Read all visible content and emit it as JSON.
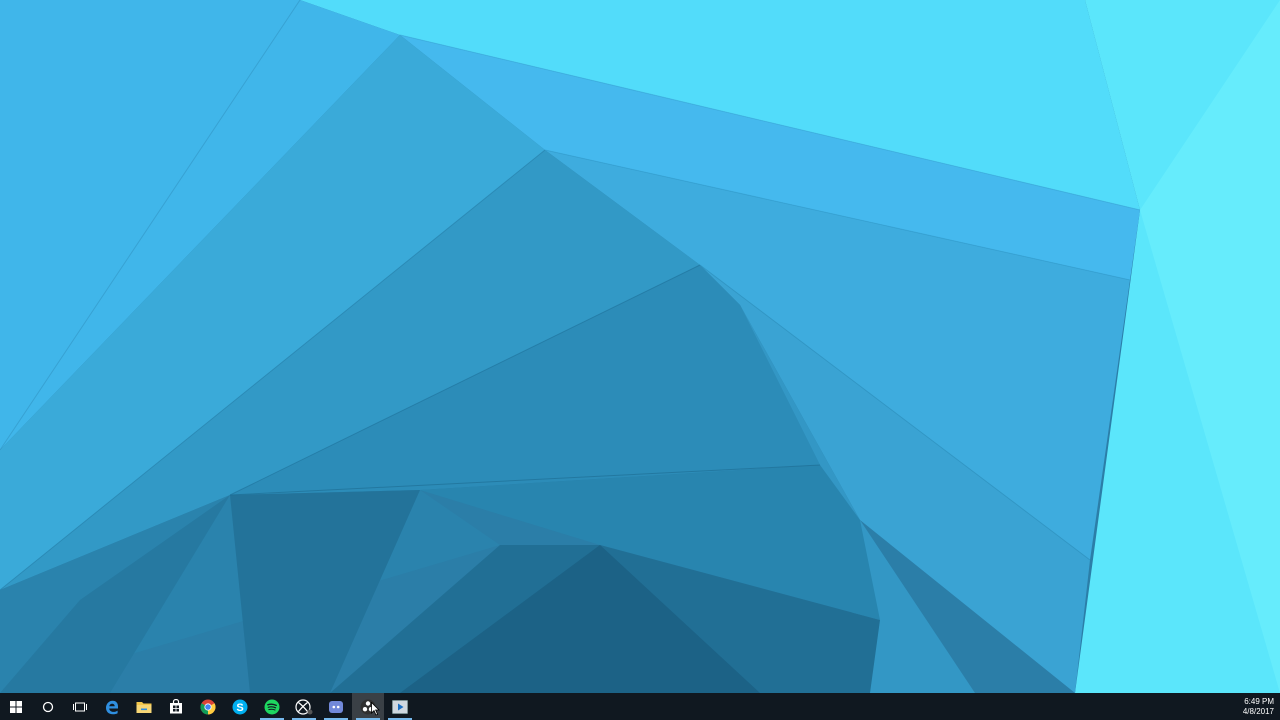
{
  "desktop": {
    "wallpaper_name": "geometric-blue-wallpaper"
  },
  "taskbar": {
    "items": [
      {
        "name": "start-button",
        "icon": "windows-logo-icon",
        "running": false
      },
      {
        "name": "search-button",
        "icon": "cortana-circle-icon",
        "running": false
      },
      {
        "name": "task-view-button",
        "icon": "task-view-icon",
        "running": false
      },
      {
        "name": "edge-button",
        "icon": "edge-icon",
        "running": false
      },
      {
        "name": "file-explorer-button",
        "icon": "folder-icon",
        "running": false
      },
      {
        "name": "store-button",
        "icon": "store-bag-icon",
        "running": false
      },
      {
        "name": "chrome-button",
        "icon": "chrome-icon",
        "running": false
      },
      {
        "name": "skype-button",
        "icon": "skype-icon",
        "running": false
      },
      {
        "name": "spotify-button",
        "icon": "spotify-icon",
        "running": true
      },
      {
        "name": "xbox-button",
        "icon": "xbox-icon",
        "running": true
      },
      {
        "name": "discord-button",
        "icon": "discord-icon",
        "running": true
      },
      {
        "name": "obs-button",
        "icon": "obs-icon",
        "running": true
      },
      {
        "name": "media-player-button",
        "icon": "media-player-icon",
        "running": true
      }
    ],
    "clock": {
      "time": "6:49 PM",
      "date": "4/8/2017"
    }
  },
  "colors": {
    "taskbar": "#101820",
    "running_indicator": "#76b9ed",
    "wallpaper_light": "#5ae6fb",
    "wallpaper_dark": "#1a5e80"
  }
}
